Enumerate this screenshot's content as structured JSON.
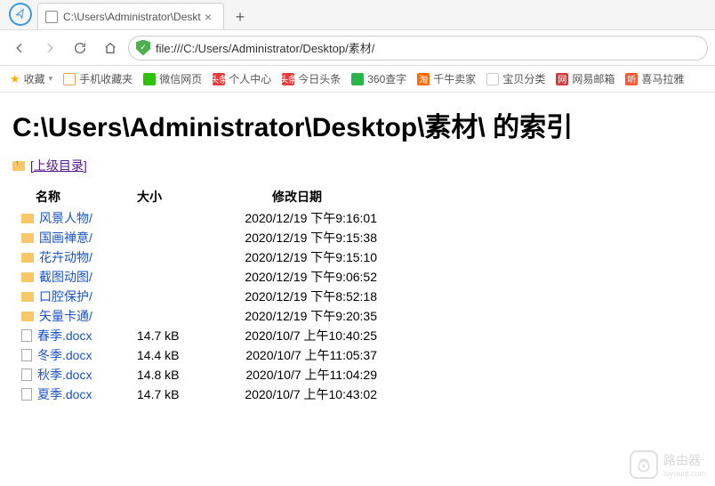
{
  "browser": {
    "tab_title": "C:\\Users\\Administrator\\Deskt",
    "url": "file:///C:/Users/Administrator/Desktop/素材/"
  },
  "bookmarks_bar": {
    "favorites_label": "收藏",
    "items": [
      {
        "label": "手机收藏夹",
        "icon_bg": "#ffffff",
        "icon_border": "#f0a050",
        "icon_text": ""
      },
      {
        "label": "微信网页",
        "icon_bg": "#2dc100",
        "icon_text": ""
      },
      {
        "label": "个人中心",
        "icon_bg": "#e63c3c",
        "icon_text": "头条"
      },
      {
        "label": "今日头条",
        "icon_bg": "#e63c3c",
        "icon_text": "头条"
      },
      {
        "label": "360查字",
        "icon_bg": "#2ab54a",
        "icon_text": ""
      },
      {
        "label": "千牛卖家",
        "icon_bg": "#ff6a00",
        "icon_text": "淘"
      },
      {
        "label": "宝贝分类",
        "icon_bg": "#ffffff",
        "icon_border": "#ccc",
        "icon_text": ""
      },
      {
        "label": "网易邮箱",
        "icon_bg": "#d33a3a",
        "icon_text": "网"
      },
      {
        "label": "喜马拉雅",
        "icon_bg": "#ff5837",
        "icon_text": "听"
      }
    ]
  },
  "page": {
    "title": "C:\\Users\\Administrator\\Desktop\\素材\\ 的索引",
    "parent_link_label": "[上级目录]",
    "columns": {
      "name": "名称",
      "size": "大小",
      "date": "修改日期"
    },
    "rows": [
      {
        "type": "dir",
        "name": "风景人物/",
        "size": "",
        "date": "2020/12/19 下午9:16:01"
      },
      {
        "type": "dir",
        "name": "国画禅意/",
        "size": "",
        "date": "2020/12/19 下午9:15:38"
      },
      {
        "type": "dir",
        "name": "花卉动物/",
        "size": "",
        "date": "2020/12/19 下午9:15:10"
      },
      {
        "type": "dir",
        "name": "截图动图/",
        "size": "",
        "date": "2020/12/19 下午9:06:52"
      },
      {
        "type": "dir",
        "name": "口腔保护/",
        "size": "",
        "date": "2020/12/19 下午8:52:18"
      },
      {
        "type": "dir",
        "name": "矢量卡通/",
        "size": "",
        "date": "2020/12/19 下午9:20:35"
      },
      {
        "type": "file",
        "name": "春季.docx",
        "size": "14.7 kB",
        "date": "2020/10/7 上午10:40:25"
      },
      {
        "type": "file",
        "name": "冬季.docx",
        "size": "14.4 kB",
        "date": "2020/10/7 上午11:05:37"
      },
      {
        "type": "file",
        "name": "秋季.docx",
        "size": "14.8 kB",
        "date": "2020/10/7 上午11:04:29"
      },
      {
        "type": "file",
        "name": "夏季.docx",
        "size": "14.7 kB",
        "date": "2020/10/7 上午10:43:02"
      }
    ]
  },
  "watermark": {
    "text": "路由器",
    "sub": "luyouqi.com"
  }
}
